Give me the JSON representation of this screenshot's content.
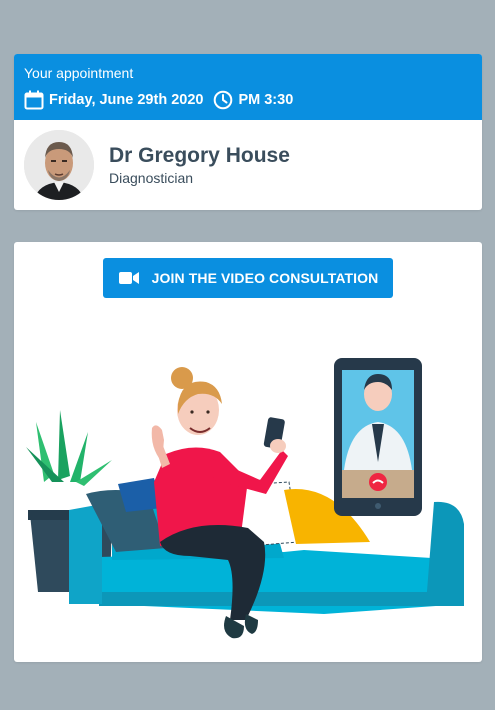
{
  "appointment": {
    "title": "Your appointment",
    "date": "Friday, June 29th 2020",
    "time": "PM 3:30",
    "calendar_icon": "calendar-icon",
    "clock_icon": "clock-icon"
  },
  "doctor": {
    "name": "Dr Gregory House",
    "role": "Diagnostician"
  },
  "video": {
    "join_label": "JOIN THE VIDEO CONSULTATION",
    "camera_icon": "video-camera-icon"
  },
  "colors": {
    "page_background": "#a3b0b8",
    "accent": "#0a8fe0",
    "text_dark": "#3a4d5c",
    "sofa": "#00b3d8",
    "shirt": "#f0164a"
  }
}
